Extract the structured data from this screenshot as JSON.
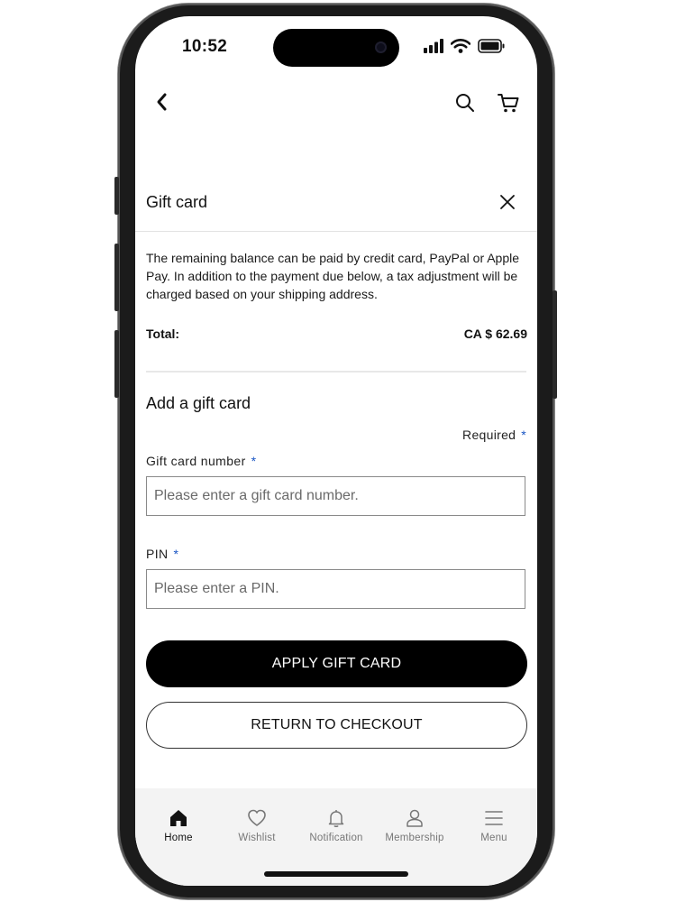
{
  "status_bar": {
    "time": "10:52"
  },
  "modal": {
    "title": "Gift card",
    "description": "The remaining balance can be paid by credit card, PayPal or Apple Pay. In addition to the payment due below, a tax adjustment will be charged based on your shipping address.",
    "total_label": "Total:",
    "total_value": "CA $ 62.69"
  },
  "form": {
    "section_title": "Add a gift card",
    "required_text": "Required",
    "required_marker": "*",
    "gift_card_label": "Gift card number",
    "gift_card_placeholder": "Please enter a gift card number.",
    "pin_label": "PIN",
    "pin_placeholder": "Please enter a PIN."
  },
  "buttons": {
    "apply": "APPLY GIFT CARD",
    "return": "RETURN TO CHECKOUT"
  },
  "tab_bar": {
    "items": [
      {
        "label": "Home",
        "icon": "home-icon",
        "active": true
      },
      {
        "label": "Wishlist",
        "icon": "heart-icon",
        "active": false
      },
      {
        "label": "Notification",
        "icon": "bell-icon",
        "active": false
      },
      {
        "label": "Membership",
        "icon": "person-icon",
        "active": false
      },
      {
        "label": "Menu",
        "icon": "hamburger-icon",
        "active": false
      }
    ]
  },
  "colors": {
    "accent_star": "#1a56c4",
    "primary_button": "#000000",
    "tab_bar_bg": "#f3f3f3"
  }
}
